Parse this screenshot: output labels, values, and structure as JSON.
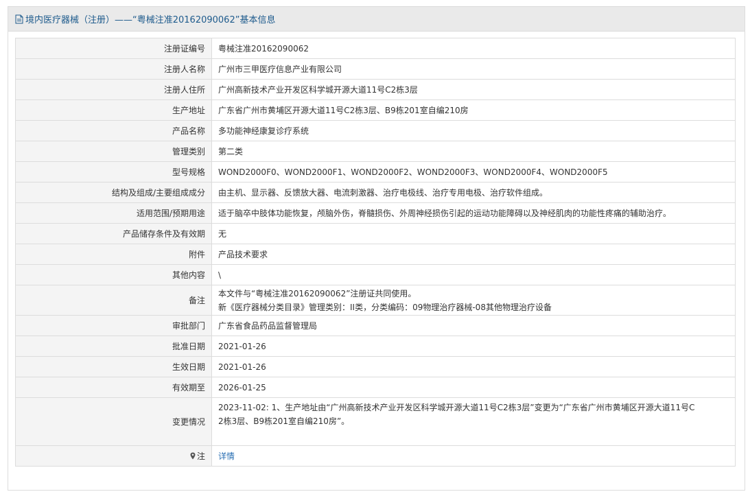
{
  "header": {
    "title": "境内医疗器械（注册）——“粤械注准20162090062”基本信息",
    "icon": "document-icon"
  },
  "rows": [
    {
      "label": "注册证编号",
      "value": "粤械注准20162090062"
    },
    {
      "label": "注册人名称",
      "value": "广州市三甲医疗信息产业有限公司"
    },
    {
      "label": "注册人住所",
      "value": "广州高新技术产业开发区科学城开源大道11号C2栋3层"
    },
    {
      "label": "生产地址",
      "value": "广东省广州市黄埔区开源大道11号C2栋3层、B9栋201室自编210房"
    },
    {
      "label": "产品名称",
      "value": "多功能神经康复诊疗系统"
    },
    {
      "label": "管理类别",
      "value": "第二类"
    },
    {
      "label": "型号规格",
      "value": "WOND2000F0、WOND2000F1、WOND2000F2、WOND2000F3、WOND2000F4、WOND2000F5"
    },
    {
      "label": "结构及组成/主要组成成分",
      "value": "由主机、显示器、反馈放大器、电流刺激器、治疗电极线、治疗专用电极、治疗软件组成。"
    },
    {
      "label": "适用范围/预期用途",
      "value": "适于脑卒中肢体功能恢复，颅脑外伤，脊髓损伤、外周神经损伤引起的运动功能障碍以及神经肌肉的功能性疼痛的辅助治疗。"
    },
    {
      "label": "产品储存条件及有效期",
      "value": "无"
    },
    {
      "label": "附件",
      "value": "产品技术要求"
    },
    {
      "label": "其他内容",
      "value": "\\"
    }
  ],
  "remark": {
    "label": "备注",
    "line1": "本文件与“粤械注准20162090062”注册证共同使用。",
    "line2": "新《医疗器械分类目录》管理类别：II类，分类编码：09物理治疗器械-08其他物理治疗设备"
  },
  "rows2": [
    {
      "label": "审批部门",
      "value": "广东省食品药品监督管理局"
    },
    {
      "label": "批准日期",
      "value": "2021-01-26"
    },
    {
      "label": "生效日期",
      "value": "2021-01-26"
    },
    {
      "label": "有效期至",
      "value": "2026-01-25"
    }
  ],
  "change": {
    "label": "变更情况",
    "line1": "2023-11-02: 1、生产地址由“广州高新技术产业开发区科学城开源大道11号C2栋3层”变更为“广东省广州市黄埔区开源大道11号C",
    "line2": "2栋3层、B9栋201室自编210房”。"
  },
  "note": {
    "label": "注",
    "icon": "pin-icon",
    "link": "详情",
    "link_color": "#2a6fb3"
  },
  "colors": {
    "header_text": "#1d5a8c",
    "header_bg": "#eaeaea",
    "label_bg": "#f4f4f4",
    "border": "#dcdcdc"
  }
}
